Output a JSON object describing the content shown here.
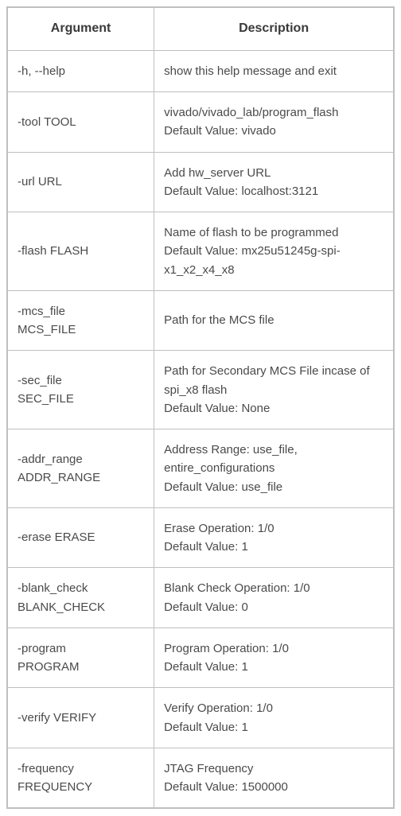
{
  "headers": {
    "argument": "Argument",
    "description": "Description"
  },
  "rows": [
    {
      "arg": [
        "-h, --help"
      ],
      "desc": [
        "show this help message and exit"
      ]
    },
    {
      "arg": [
        "-tool TOOL"
      ],
      "desc": [
        "vivado/vivado_lab/program_flash",
        "Default Value: vivado"
      ]
    },
    {
      "arg": [
        "-url URL"
      ],
      "desc": [
        "Add hw_server URL",
        "Default Value: localhost:3121"
      ]
    },
    {
      "arg": [
        "-flash FLASH"
      ],
      "desc": [
        "Name of flash to be programmed",
        "Default Value: mx25u51245g-spi-x1_x2_x4_x8"
      ]
    },
    {
      "arg": [
        "-mcs_file",
        "MCS_FILE"
      ],
      "desc": [
        "Path for the MCS file"
      ]
    },
    {
      "arg": [
        "-sec_file",
        "SEC_FILE"
      ],
      "desc": [
        "Path for Secondary MCS File incase of spi_x8 flash",
        "Default Value: None"
      ]
    },
    {
      "arg": [
        "-addr_range",
        "ADDR_RANGE"
      ],
      "desc": [
        "Address Range: use_file, entire_configurations",
        "Default Value: use_file"
      ]
    },
    {
      "arg": [
        "-erase ERASE"
      ],
      "desc": [
        "Erase Operation: 1/0",
        "Default Value: 1"
      ]
    },
    {
      "arg": [
        "-blank_check",
        "BLANK_CHECK"
      ],
      "desc": [
        "Blank Check Operation: 1/0",
        "Default Value: 0"
      ]
    },
    {
      "arg": [
        "-program",
        "PROGRAM"
      ],
      "desc": [
        "Program Operation: 1/0",
        "Default Value: 1"
      ]
    },
    {
      "arg": [
        "-verify VERIFY"
      ],
      "desc": [
        "Verify Operation: 1/0",
        "Default Value: 1"
      ]
    },
    {
      "arg": [
        "-frequency",
        "FREQUENCY"
      ],
      "desc": [
        "JTAG Frequency",
        "Default Value: 1500000"
      ]
    }
  ]
}
